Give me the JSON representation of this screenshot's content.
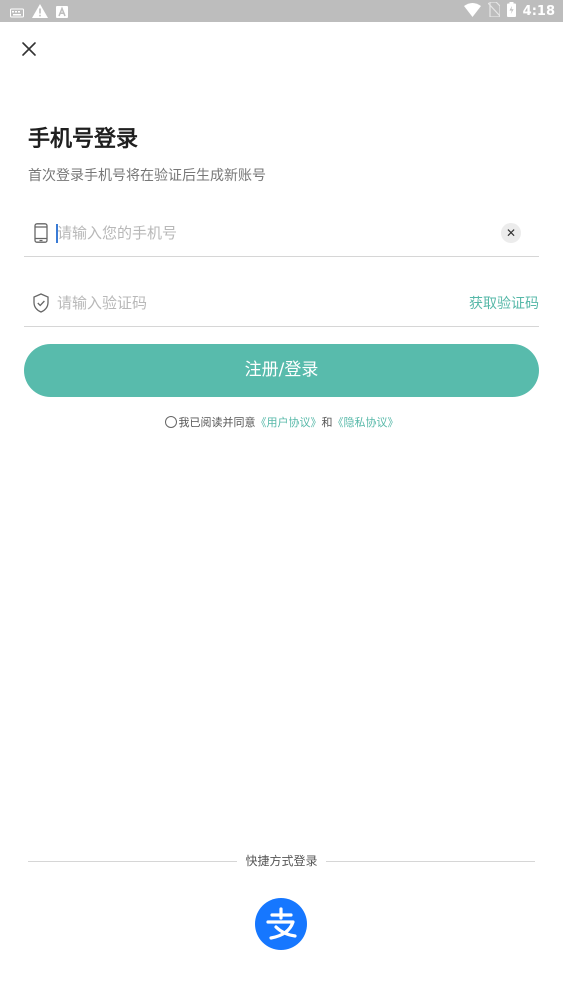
{
  "status_bar": {
    "time": "4:18",
    "left_icons": [
      "keyboard-icon",
      "warning-icon",
      "font-icon"
    ],
    "right_icons": [
      "wifi-icon",
      "no-sim-icon",
      "battery-icon"
    ]
  },
  "header": {
    "close_icon": "close-icon"
  },
  "title": "手机号登录",
  "subtitle": "首次登录手机号将在验证后生成新账号",
  "phone_field": {
    "placeholder": "请输入您的手机号",
    "value": "",
    "icon": "phone-icon",
    "clear_label": "✕"
  },
  "code_field": {
    "placeholder": "请输入验证码",
    "value": "",
    "icon": "shield-icon",
    "get_code_label": "获取验证码"
  },
  "submit_label": "注册/登录",
  "agreement": {
    "prefix": "我已阅读并同意",
    "user_agreement": "《用户协议》",
    "and": "和",
    "privacy_policy": "《隐私协议》"
  },
  "quick_login": {
    "label": "快捷方式登录",
    "alipay_icon": "alipay-icon"
  },
  "colors": {
    "accent": "#58bbac",
    "link": "#56b8a8",
    "alipay": "#1677ff",
    "status_bar": "#bdbdbd"
  }
}
